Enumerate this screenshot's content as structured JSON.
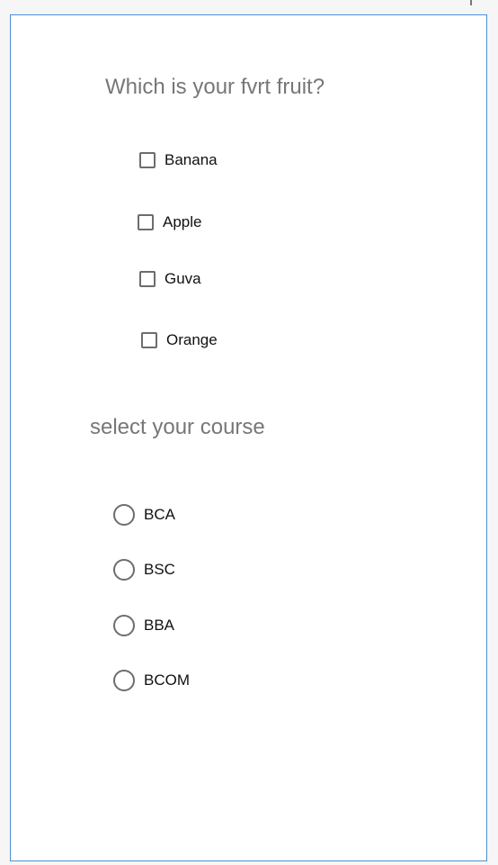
{
  "fruit_question": {
    "title": "Which is your fvrt fruit?",
    "options": [
      {
        "label": "Banana",
        "checked": false
      },
      {
        "label": "Apple",
        "checked": false
      },
      {
        "label": "Guva",
        "checked": false
      },
      {
        "label": "Orange",
        "checked": false
      }
    ]
  },
  "course_question": {
    "title": "select your course",
    "options": [
      {
        "label": "BCA",
        "selected": false
      },
      {
        "label": "BSC",
        "selected": false
      },
      {
        "label": "BBA",
        "selected": false
      },
      {
        "label": "BCOM",
        "selected": false
      }
    ]
  },
  "colors": {
    "frame_border": "#4a90d9",
    "question_text": "#777777",
    "control_border": "#6d6d6d"
  }
}
